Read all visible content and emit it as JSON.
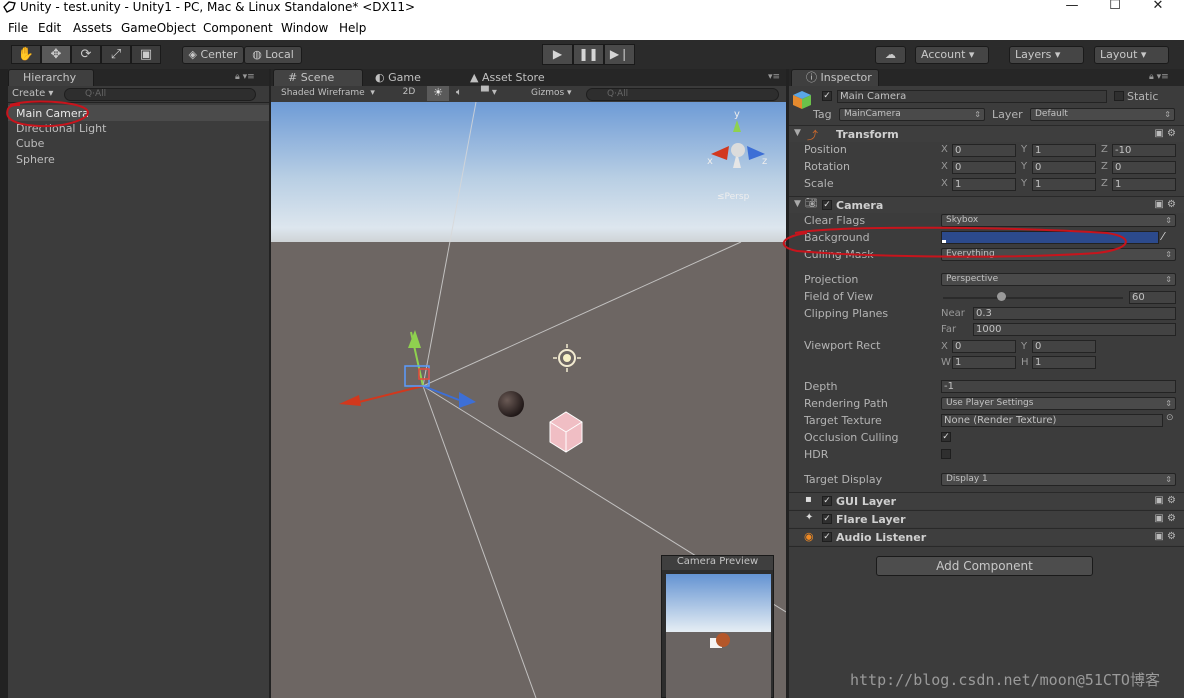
{
  "window": {
    "title": "Unity - test.unity - Unity1 - PC, Mac & Linux Standalone* <DX11>",
    "minimize": "—",
    "maximize": "☐",
    "close": "✕"
  },
  "menu": [
    "File",
    "Edit",
    "Assets",
    "GameObject",
    "Component",
    "Window",
    "Help"
  ],
  "toolbar": {
    "tools": [
      "hand-icon",
      "move-icon",
      "rotate-icon",
      "scale-icon",
      "rect-icon"
    ],
    "center": "Center",
    "local": "Local",
    "cloud": "cloud-icon",
    "account": "Account",
    "layers": "Layers",
    "layout": "Layout"
  },
  "hierarchy": {
    "tab": "Hierarchy",
    "create": "Create",
    "search": "Q·All",
    "items": [
      "Main Camera",
      "Directional Light",
      "Cube",
      "Sphere"
    ],
    "selected": 0
  },
  "scene": {
    "tabs": [
      "Scene",
      "Game",
      "Asset Store"
    ],
    "shading": "Shaded Wireframe",
    "mode2d": "2D",
    "gizmos": "Gizmos",
    "search": "Q·All",
    "persp": "≤Persp",
    "camera_preview": "Camera Preview"
  },
  "inspector": {
    "tab": "Inspector",
    "object_name": "Main Camera",
    "static_label": "Static",
    "tag_label": "Tag",
    "tag_value": "MainCamera",
    "layer_label": "Layer",
    "layer_value": "Default",
    "transform": {
      "title": "Transform",
      "position_label": "Position",
      "position": [
        "0",
        "1",
        "-10"
      ],
      "rotation_label": "Rotation",
      "rotation": [
        "0",
        "0",
        "0"
      ],
      "scale_label": "Scale",
      "scale": [
        "1",
        "1",
        "1"
      ],
      "axes": [
        "X",
        "Y",
        "Z"
      ]
    },
    "camera": {
      "title": "Camera",
      "clear_flags_label": "Clear Flags",
      "clear_flags": "Skybox",
      "background_label": "Background",
      "background_color": "#2c4a8c",
      "culling_mask_label": "Culling Mask",
      "culling_mask": "Everything",
      "projection_label": "Projection",
      "projection": "Perspective",
      "fov_label": "Field of View",
      "fov": "60",
      "clipping_label": "Clipping Planes",
      "near_label": "Near",
      "near": "0.3",
      "far_label": "Far",
      "far": "1000",
      "viewport_label": "Viewport Rect",
      "vx": "0",
      "vy": "0",
      "vw": "1",
      "vh": "1",
      "x_label": "X",
      "y_label": "Y",
      "w_label": "W",
      "h_label": "H",
      "depth_label": "Depth",
      "depth": "-1",
      "rendering_path_label": "Rendering Path",
      "rendering_path": "Use Player Settings",
      "target_texture_label": "Target Texture",
      "target_texture": "None (Render Texture)",
      "occlusion_label": "Occlusion Culling",
      "hdr_label": "HDR",
      "target_display_label": "Target Display",
      "target_display": "Display 1"
    },
    "components": [
      "GUI Layer",
      "Flare Layer",
      "Audio Listener"
    ],
    "add_component": "Add Component"
  },
  "watermark": "http://blog.csdn.net/moon@51CTO博客"
}
